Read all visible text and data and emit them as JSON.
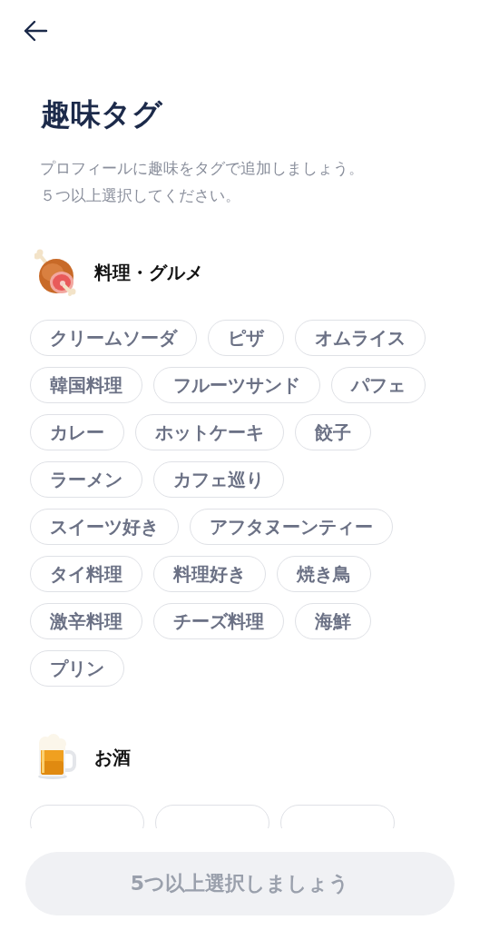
{
  "title": "趣味タグ",
  "description": [
    "プロフィールに趣味をタグで追加しましょう。",
    "５つ以上選択してください。"
  ],
  "categories": [
    {
      "kind": "meat",
      "name": "料理・グルメ",
      "tags": [
        {
          "label": "クリームソーダ",
          "selected": false
        },
        {
          "label": "ピザ",
          "selected": false
        },
        {
          "label": "オムライス",
          "selected": false
        },
        {
          "label": "韓国料理",
          "selected": false
        },
        {
          "label": "フルーツサンド",
          "selected": false
        },
        {
          "label": "パフェ",
          "selected": false
        },
        {
          "label": "カレー",
          "selected": false
        },
        {
          "label": "ホットケーキ",
          "selected": false
        },
        {
          "label": "餃子",
          "selected": false
        },
        {
          "label": "ラーメン",
          "selected": false
        },
        {
          "label": "カフェ巡り",
          "selected": false
        },
        {
          "label": "スイーツ好き",
          "selected": false
        },
        {
          "label": "アフタヌーンティー",
          "selected": false
        },
        {
          "label": "タイ料理",
          "selected": false
        },
        {
          "label": "料理好き",
          "selected": false
        },
        {
          "label": "焼き鳥",
          "selected": false
        },
        {
          "label": "激辛料理",
          "selected": false
        },
        {
          "label": "チーズ料理",
          "selected": false
        },
        {
          "label": "海鮮",
          "selected": false
        },
        {
          "label": "プリン",
          "selected": false
        }
      ]
    },
    {
      "kind": "beer",
      "name": "お酒",
      "tags": [
        {
          "selected": false
        },
        {
          "selected": false
        },
        {
          "selected": false
        }
      ]
    }
  ],
  "submit": {
    "label": "5つ以上選択しましょう",
    "disabled": true
  }
}
